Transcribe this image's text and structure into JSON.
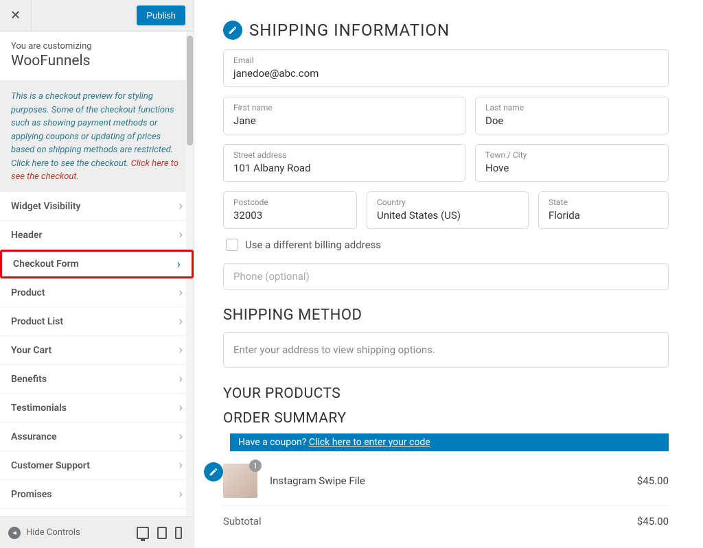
{
  "header": {
    "publish_label": "Publish",
    "customizing_label": "You are customizing",
    "site_title": "WooFunnels"
  },
  "notice": {
    "text_main": "This is a checkout preview for styling purposes. Some of the checkout functions such as showing payment methods or applying coupons or updating of prices based on shipping methods are restricted. Click here to see the checkout. ",
    "text_link": "Click here to see the checkout."
  },
  "panels": [
    {
      "label": "Widget Visibility",
      "selected": false
    },
    {
      "label": "Header",
      "selected": false
    },
    {
      "label": "Checkout Form",
      "selected": true
    },
    {
      "label": "Product",
      "selected": false
    },
    {
      "label": "Product List",
      "selected": false
    },
    {
      "label": "Your Cart",
      "selected": false
    },
    {
      "label": "Benefits",
      "selected": false
    },
    {
      "label": "Testimonials",
      "selected": false
    },
    {
      "label": "Assurance",
      "selected": false
    },
    {
      "label": "Customer Support",
      "selected": false
    },
    {
      "label": "Promises",
      "selected": false
    }
  ],
  "bottom": {
    "hide_label": "Hide Controls"
  },
  "shipping": {
    "title": "SHIPPING INFORMATION",
    "email_label": "Email",
    "email_value": "janedoe@abc.com",
    "firstname_label": "First name",
    "firstname_value": "Jane",
    "lastname_label": "Last name",
    "lastname_value": "Doe",
    "street_label": "Street address",
    "street_value": "101 Albany Road",
    "city_label": "Town / City",
    "city_value": "Hove",
    "postcode_label": "Postcode",
    "postcode_value": "32003",
    "country_label": "Country",
    "country_value": "United States (US)",
    "state_label": "State",
    "state_value": "Florida",
    "diff_billing_label": "Use a different billing address",
    "phone_placeholder": "Phone (optional)"
  },
  "shipping_method": {
    "title": "SHIPPING METHOD",
    "message": "Enter your address to view shipping options."
  },
  "products": {
    "title": "YOUR PRODUCTS",
    "summary_title": "ORDER SUMMARY",
    "coupon_prompt": "Have a coupon? ",
    "coupon_link": "Click here to enter your code",
    "item_qty": "1",
    "item_name": "Instagram Swipe File",
    "item_price": "$45.00",
    "subtotal_label": "Subtotal",
    "subtotal_value": "$45.00"
  }
}
